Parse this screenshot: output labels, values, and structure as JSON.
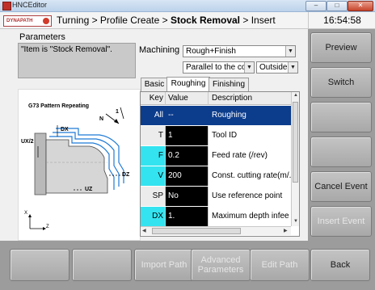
{
  "window": {
    "title": "HNCEditor",
    "controls": [
      "–",
      "□",
      "✕"
    ]
  },
  "header": {
    "logo_text": "DYNAPATH",
    "breadcrumb": {
      "part1": "Turning > Profile Create > ",
      "current": "Stock Removal",
      "part3": " > Insert"
    },
    "clock": "16:54:58"
  },
  "params": {
    "title": "Parameters",
    "message": "\"Item is \"Stock Removal\"."
  },
  "machining": {
    "label": "Machining",
    "mode": "Rough+Finish",
    "direction": "Parallel to the co",
    "side": "Outside"
  },
  "tabs": [
    {
      "label": "Basic",
      "active": false
    },
    {
      "label": "Roughing",
      "active": true
    },
    {
      "label": "Finishing",
      "active": false
    }
  ],
  "diagram": {
    "title": "G73 Pattern Repeating",
    "labels": {
      "n": "N",
      "one": "1",
      "dx": "DX",
      "ux2": "UX/2",
      "dz": "DZ",
      "uz": "UZ",
      "x": "X",
      "z": "Z"
    }
  },
  "table": {
    "headers": {
      "key": "Key",
      "value": "Value",
      "description": "Description"
    },
    "rows": [
      {
        "key": "All",
        "value": "--",
        "description": "Roughing",
        "style": "selected"
      },
      {
        "key": "T",
        "value": "1",
        "description": "Tool ID",
        "style": "normal"
      },
      {
        "key": "F",
        "value": "0.2",
        "description": "Feed rate (/rev)",
        "style": "cyan"
      },
      {
        "key": "V",
        "value": "200",
        "description": "Const. cutting rate(m/.",
        "style": "cyan"
      },
      {
        "key": "SP",
        "value": "No",
        "description": "Use reference point",
        "style": "normal"
      },
      {
        "key": "DX",
        "value": "1.",
        "description": "Maximum depth infee",
        "style": "cyan"
      }
    ]
  },
  "right_buttons": [
    {
      "label": "Preview",
      "enabled": true
    },
    {
      "label": "Switch",
      "enabled": true
    },
    {
      "label": "",
      "enabled": true
    },
    {
      "label": "",
      "enabled": true
    },
    {
      "label": "Cancel Event",
      "enabled": true
    },
    {
      "label": "Insert Event",
      "enabled": false
    }
  ],
  "bottom_buttons": [
    {
      "label": "",
      "enabled": true
    },
    {
      "label": "",
      "enabled": true
    },
    {
      "label": "Import Path",
      "enabled": false
    },
    {
      "label": "Advanced Parameters",
      "enabled": false
    },
    {
      "label": "Edit Path",
      "enabled": false
    },
    {
      "label": "Back",
      "enabled": true
    }
  ],
  "colors": {
    "selected_row": "#0c3c8c",
    "key_highlight": "#33e3ef",
    "value_bg": "#000000",
    "button_bar": "#9c9c9c"
  }
}
